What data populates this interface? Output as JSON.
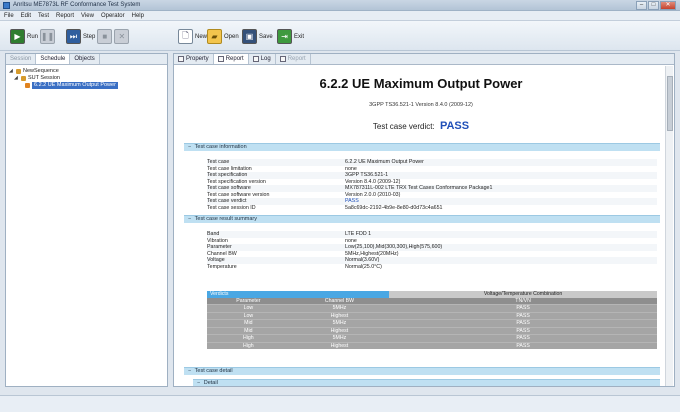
{
  "window": {
    "title": "Anritsu ME7873L RF Conformance Test System"
  },
  "menu": [
    "File",
    "Edit",
    "Test",
    "Report",
    "View",
    "Operator",
    "Help"
  ],
  "toolbar": {
    "run": "Run",
    "step": "Step",
    "new": "New",
    "open": "Open",
    "save": "Save",
    "exit": "Exit"
  },
  "left_tabs": [
    "Session",
    "Schedule",
    "Objects"
  ],
  "tree": {
    "root": "NewSequence",
    "session": "SUT Session",
    "case": "6.2.2 UE Maximum Output Power"
  },
  "right_tabs": [
    "Property",
    "Report",
    "Log",
    "Report"
  ],
  "report": {
    "title": "6.2.2  UE Maximum Output Power",
    "spec_line": "3GPP TS36.521-1   Version 8.4.0 (2009-12)",
    "verdict_label": "Test case verdict:",
    "verdict": "PASS",
    "sections": {
      "info": "Test case information",
      "summary": "Test case result summary",
      "detail": "Test case detail",
      "detail_sub": "Detail"
    },
    "info_rows": [
      {
        "k": "Test case",
        "v": "6.2.2 UE Maximum Output Power"
      },
      {
        "k": "Test case limitation",
        "v": "none"
      },
      {
        "k": "Test specification",
        "v": "3GPP TS36.521-1"
      },
      {
        "k": "Test specification version",
        "v": "Version 8.4.0 (2009-12)"
      },
      {
        "k": "Test case software",
        "v": "MX787311L-002 LTE TRX Test Cases Conformance Package1"
      },
      {
        "k": "Test case software version",
        "v": "Version 2.0.0 (2010-03)"
      },
      {
        "k": "Test case verdict",
        "v": "PASS"
      },
      {
        "k": "Test case session ID",
        "v": "5a8c69dc-2192-4b9e-8e80-d0d73c4a651"
      }
    ],
    "summary_rows": [
      {
        "k": "Band",
        "v": "LTE FDD 1"
      },
      {
        "k": "Vibration",
        "v": "none"
      },
      {
        "k": "Parameter",
        "v": "Low(25,100),Mid(300,300),High(575,600)"
      },
      {
        "k": "Channel BW",
        "v": "5MHz,Highest(20MHz)"
      },
      {
        "k": "Voltage",
        "v": "Normal(3.60V)"
      },
      {
        "k": "Temperature",
        "v": "Normal(25.0°C)"
      }
    ],
    "verdicts_table": {
      "caption_left": "Verdicts",
      "caption_right": "Voltage/Temperature Combination",
      "headers": [
        "Parameter",
        "Channel BW",
        "TN/VN"
      ],
      "rows": [
        [
          "Low",
          "5MHz",
          "PASS"
        ],
        [
          "Low",
          "Highest",
          "PASS"
        ],
        [
          "Mid",
          "5MHz",
          "PASS"
        ],
        [
          "Mid",
          "Highest",
          "PASS"
        ],
        [
          "High",
          "5MHz",
          "PASS"
        ],
        [
          "High",
          "Highest",
          "PASS"
        ]
      ]
    }
  }
}
